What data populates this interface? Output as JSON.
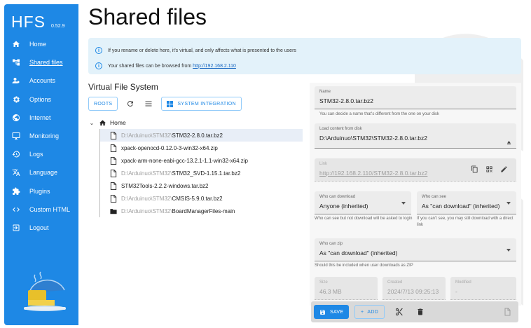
{
  "app": {
    "name": "HFS",
    "version": "0.52.9"
  },
  "nav": [
    {
      "label": "Home",
      "icon": "home-icon"
    },
    {
      "label": "Shared files",
      "icon": "tree-icon",
      "active": true
    },
    {
      "label": "Accounts",
      "icon": "accounts-icon"
    },
    {
      "label": "Options",
      "icon": "gear-icon"
    },
    {
      "label": "Internet",
      "icon": "globe-icon"
    },
    {
      "label": "Monitoring",
      "icon": "monitor-icon"
    },
    {
      "label": "Logs",
      "icon": "history-icon"
    },
    {
      "label": "Language",
      "icon": "translate-icon"
    },
    {
      "label": "Plugins",
      "icon": "puzzle-icon"
    },
    {
      "label": "Custom HTML",
      "icon": "code-icon"
    },
    {
      "label": "Logout",
      "icon": "logout-icon"
    }
  ],
  "page": {
    "title": "Shared files",
    "alert_line1": "If you rename or delete here, it's virtual, and only affects what is presented to the users",
    "alert_line2_prefix": "Your shared files can be browsed from",
    "alert_link": "http://192.168.2.110"
  },
  "vfs": {
    "title": "Virtual File System",
    "roots_label": "ROOTS",
    "system_integration_label": "SYSTEM INTEGRATION",
    "root_label": "Home",
    "items": [
      {
        "prefix": "D:\\Arduinuo\\STM32\\",
        "name": "STM32-2.8.0.tar.bz2",
        "type": "file",
        "selected": true
      },
      {
        "prefix": "",
        "name": "xpack-openocd-0.12.0-3-win32-x64.zip",
        "type": "file"
      },
      {
        "prefix": "",
        "name": "xpack-arm-none-eabi-gcc-13.2.1-1.1-win32-x64.zip",
        "type": "file"
      },
      {
        "prefix": "D:\\Arduinuo\\STM32\\",
        "name": "STM32_SVD-1.15.1.tar.bz2",
        "type": "file"
      },
      {
        "prefix": "",
        "name": "STM32Tools-2.2.2-windows.tar.bz2",
        "type": "file"
      },
      {
        "prefix": "D:\\Arduinuo\\STM32\\",
        "name": "CMSIS-5.9.0.tar.bz2",
        "type": "file"
      },
      {
        "prefix": "D:\\Arduinuo\\STM32\\",
        "name": "BoardManagerFiles-main",
        "type": "folder"
      }
    ]
  },
  "details": {
    "name_label": "Name",
    "name_value": "STM32-2.8.0.tar.bz2",
    "name_helper": "You can decide a name that's different from the one on your disk",
    "source_label": "Load content from disk",
    "source_value": "D:\\Arduinuo\\STM32\\STM32-2.8.0.tar.bz2",
    "link_label": "Link",
    "link_value": "http://192.168.2.110/STM32-2.8.0.tar.bz2",
    "can_download_label": "Who can download",
    "can_download_value": "Anyone (inherited)",
    "can_download_helper": "Who can see but not download will be asked to login",
    "can_see_label": "Who can see",
    "can_see_value": "As \"can download\" (inherited)",
    "can_see_helper": "If you can't see, you may still download with a direct link",
    "can_zip_label": "Who can zip",
    "can_zip_value": "As \"can download\" (inherited)",
    "can_zip_helper": "Should this be included when user downloads as ZIP",
    "size_label": "Size",
    "size_value": "46.3 MB",
    "created_label": "Created",
    "created_value": "2024/7/13 09:25:13",
    "modified_label": "Modified",
    "modified_value": "-"
  },
  "actions": {
    "save_label": "SAVE",
    "add_label": "ADD"
  }
}
